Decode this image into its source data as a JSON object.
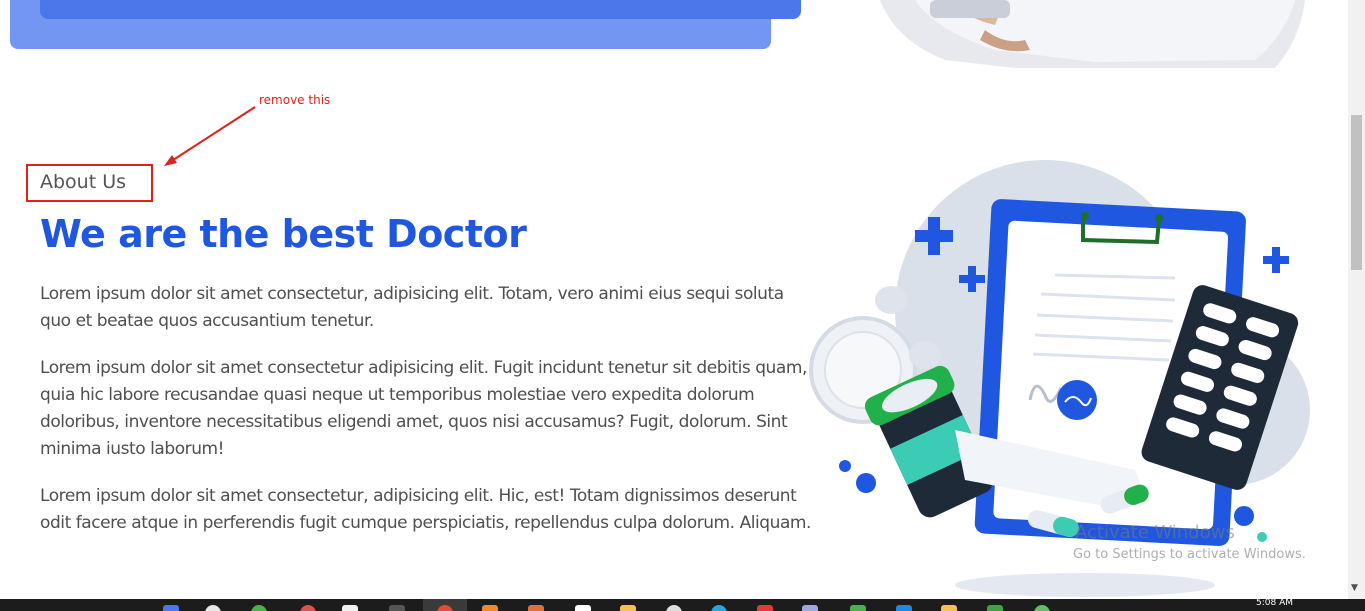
{
  "annotation": {
    "note": "remove this"
  },
  "about": {
    "eyebrow": "About Us",
    "title": "We are the best Doctor",
    "paragraphs": [
      "Lorem ipsum dolor sit amet consectetur, adipisicing elit. Totam, vero animi eius sequi soluta quo et beatae quos accusantium tenetur.",
      "Lorem ipsum dolor sit amet consectetur adipisicing elit. Fugit incidunt tenetur sit debitis quam, quia hic labore recusandae quasi neque ut temporibus molestiae vero expedita dolorum doloribus, inventore necessitatibus eligendi amet, quos nisi accusamus? Fugit, dolorum. Sint minima iusto laborum!",
      "Lorem ipsum dolor sit amet consectetur, adipisicing elit. Hic, est! Totam dignissimos deserunt odit facere atque in perferendis fugit cumque perspiciatis, repellendus culpa dolorum. Aliquam."
    ]
  },
  "watermark": {
    "title": "Activate Windows",
    "subtitle": "Go to Settings to activate Windows."
  },
  "taskbar": {
    "clock": "5:08 AM"
  },
  "colors": {
    "accent": "#1f57e0",
    "annotation": "#e0201a",
    "card_back": "#7396f2",
    "card_front": "#4a78ea"
  }
}
